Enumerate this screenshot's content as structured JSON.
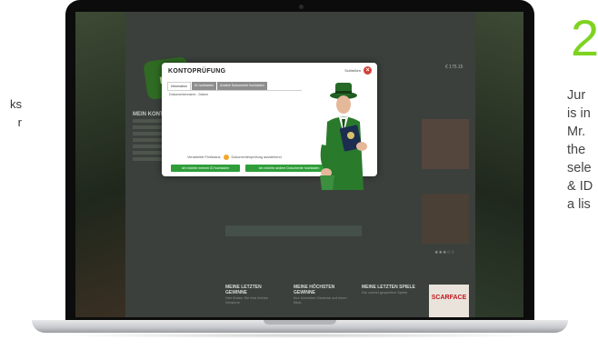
{
  "left_fragment": {
    "line1": "ks",
    "line2": "r"
  },
  "step": {
    "number": "2",
    "lines": [
      "Jur",
      "is in",
      "Mr.",
      "the",
      "sele",
      "& ID",
      "a lis"
    ]
  },
  "site": {
    "logo": "mr",
    "side_title": "MEIN KONTO",
    "top_right": "€ 175.15",
    "footer": [
      {
        "title": "MEINE LETZTEN GEWINNE",
        "sub": "Hier finden Sie Ihre letzten Gewinne"
      },
      {
        "title": "MEINE HÖCHSTEN GEWINNE",
        "sub": "Ihre höchsten Gewinne auf einen Blick"
      },
      {
        "title": "MEINE LETZTEN SPIELE",
        "sub": "Die zuletzt gespielten Spiele"
      }
    ],
    "poster": "SCARFACE",
    "stars": "★★★☆☆"
  },
  "modal": {
    "title": "KONTOPRÜFUNG",
    "close_label": "Schließen",
    "tabs": [
      "Information",
      "ID hochladen",
      "Andere Dokumente hochladen"
    ],
    "sub_label": "Dokumentenname - Datum",
    "status_text": "Verarbeitet Prüfstatus",
    "status_pending": "Dokumentenprüfung ausstehend",
    "button_upload_id": "Ich möchte meinen ID hochladen",
    "button_upload_other": "Ich möchte andere Dokumente hochladen"
  },
  "colors": {
    "accent_green": "#7ed321",
    "button_green": "#2f9e3a",
    "close_red": "#d64037",
    "warn_orange": "#f3a62a"
  }
}
